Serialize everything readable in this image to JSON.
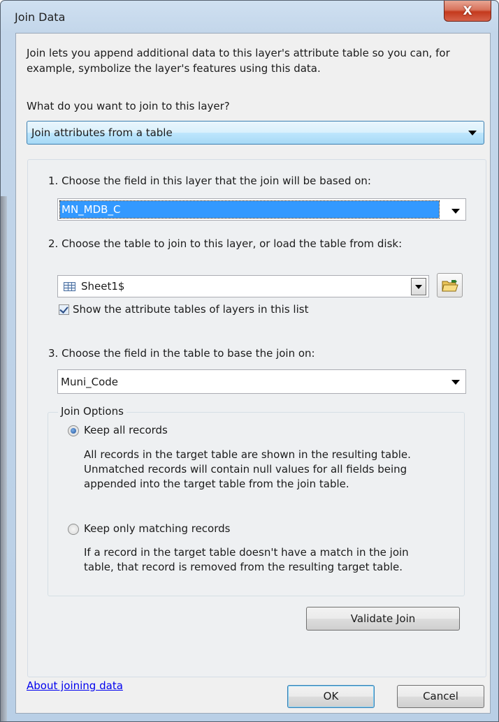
{
  "window": {
    "title": "Join Data",
    "close_glyph": "X"
  },
  "intro": "Join lets you append additional data to this layer's attribute table so you can, for example, symbolize the layer's features using this data.",
  "question": "What do you want to join to this layer?",
  "join_type": {
    "selected": "Join attributes from a table"
  },
  "step1": {
    "label": "1.  Choose the field in this layer that the join will be based on:",
    "selected": "MN_MDB_C"
  },
  "step2": {
    "label": "2.  Choose the table to join to this layer, or load the table from disk:",
    "selected": "Sheet1$",
    "table_icon": "table-icon",
    "folder_icon": "open-folder-icon",
    "checkbox_label": "Show the attribute tables of layers in this list",
    "checkbox_checked": true
  },
  "step3": {
    "label": "3.  Choose the field in the table to base the join on:",
    "selected": "Muni_Code"
  },
  "join_options": {
    "legend": "Join Options",
    "keep_all": {
      "label": "Keep all records",
      "selected": true,
      "description": [
        "All records in the target table are shown in the resulting table.",
        "Unmatched records will contain null values for all fields being",
        "appended into the target table from the join table."
      ]
    },
    "keep_matching": {
      "label": "Keep only matching records",
      "selected": false,
      "description": [
        "If a record in the target table doesn't have a match in the join",
        "table, that record is removed from the resulting target table."
      ]
    }
  },
  "buttons": {
    "validate": "Validate Join",
    "ok": "OK",
    "cancel": "Cancel"
  },
  "help_link": "About joining data",
  "colors": {
    "selection": "#3399ff",
    "link": "#0000ee",
    "dropdown_focus": "#a7d9f5"
  }
}
